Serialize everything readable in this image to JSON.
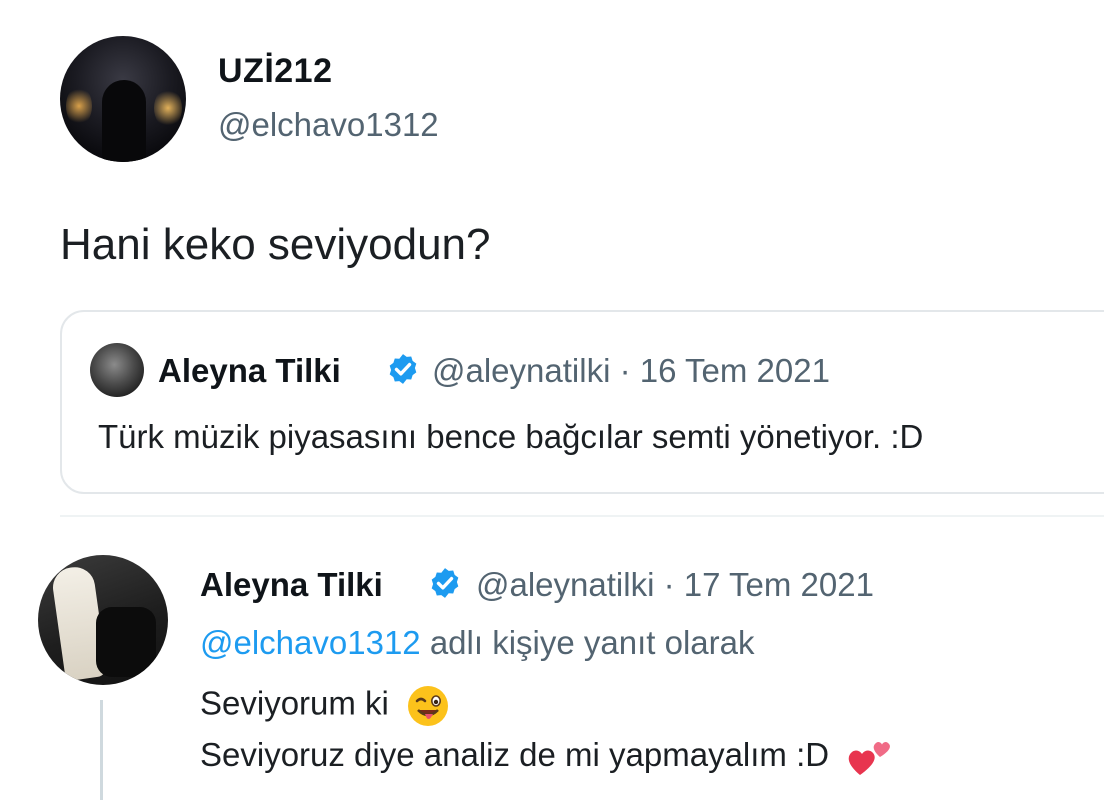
{
  "tweet": {
    "author": {
      "display_name": "UZİ212",
      "handle": "@elchavo1312"
    },
    "text": "Hani keko seviyodun?"
  },
  "quote": {
    "author": {
      "display_name": "Aleyna Tilki",
      "handle": "@aleynatilki",
      "verified": true
    },
    "separator": "·",
    "date": "16 Tem 2021",
    "text": "Türk müzik piyasasını bence bağcılar semti yönetiyor. :D"
  },
  "reply": {
    "author": {
      "display_name": "Aleyna Tilki",
      "handle": "@aleynatilki",
      "verified": true
    },
    "separator": "·",
    "date": "17 Tem 2021",
    "replying_to_mention": "@elchavo1312",
    "replying_to_suffix": "adlı kişiye yanıt olarak",
    "line1": "Seviyorum ki",
    "line1_emoji": "winking-face-with-tongue-icon",
    "line2": "Seviyoruz diye analiz de mi yapmayalım :D",
    "line2_emoji": "two-hearts-icon"
  },
  "colors": {
    "secondary_text": "#536471",
    "accent_blue": "#1d9bf0",
    "border": "#e3e7ea"
  }
}
